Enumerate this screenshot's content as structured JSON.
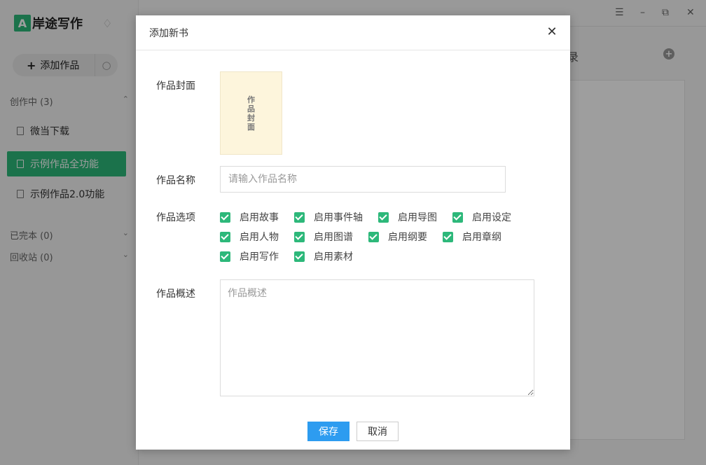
{
  "app": {
    "logo_mark": "A",
    "title": "岸途写作",
    "add_work_label": "添加作品",
    "groups": {
      "in_progress": "创作中 (3)",
      "finished": "已完本 (0)",
      "recycle": "回收站 (0)"
    },
    "works": [
      {
        "label": "微当下载",
        "active": false
      },
      {
        "label": "示例作品全功能",
        "active": true
      },
      {
        "label": "示例作品2.0功能",
        "active": false
      }
    ],
    "main_title_fragment": "录",
    "accent_color": "#2db87a"
  },
  "dialog": {
    "title": "添加新书",
    "close_icon": "close-icon",
    "cover_label": "作品封面",
    "cover_text": "作品封面",
    "name_label": "作品名称",
    "name_placeholder": "请输入作品名称",
    "options_label": "作品选项",
    "options": [
      {
        "label": "启用故事",
        "checked": true
      },
      {
        "label": "启用事件轴",
        "checked": true
      },
      {
        "label": "启用导图",
        "checked": true
      },
      {
        "label": "启用设定",
        "checked": true
      },
      {
        "label": "启用人物",
        "checked": true
      },
      {
        "label": "启用图谱",
        "checked": true
      },
      {
        "label": "启用纲要",
        "checked": true
      },
      {
        "label": "启用章纲",
        "checked": true
      },
      {
        "label": "启用写作",
        "checked": true
      },
      {
        "label": "启用素材",
        "checked": true
      }
    ],
    "desc_label": "作品概述",
    "desc_placeholder": "作品概述",
    "save_label": "保存",
    "cancel_label": "取消",
    "save_color": "#2d9cf0"
  }
}
